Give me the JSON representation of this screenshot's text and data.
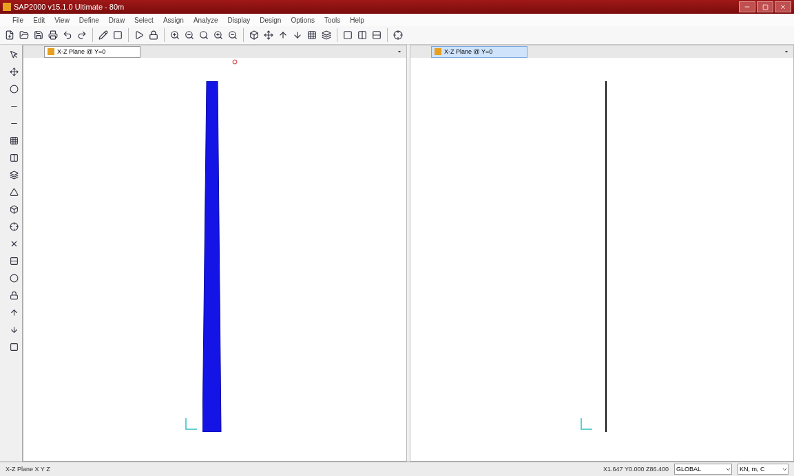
{
  "window": {
    "title": "SAP2000 v15.1.0 Ultimate - 80m"
  },
  "menu": [
    "File",
    "Edit",
    "View",
    "Define",
    "Draw",
    "Select",
    "Assign",
    "Analyze",
    "Display",
    "Design",
    "Options",
    "Tools",
    "Help"
  ],
  "panes": [
    {
      "tab": "X-Z Plane @ Y=0",
      "selected": false,
      "minimize": "-",
      "kind": "tower"
    },
    {
      "tab": "X-Z Plane @ Y=0",
      "selected": true,
      "minimize": "-",
      "kind": "line"
    }
  ],
  "status_bar": {
    "view": "X-Z Plane X Y Z",
    "coordinates": "X1.647 Y0.000 Z86.400",
    "coord_system": "GLOBAL",
    "units": "KN, m, C"
  }
}
